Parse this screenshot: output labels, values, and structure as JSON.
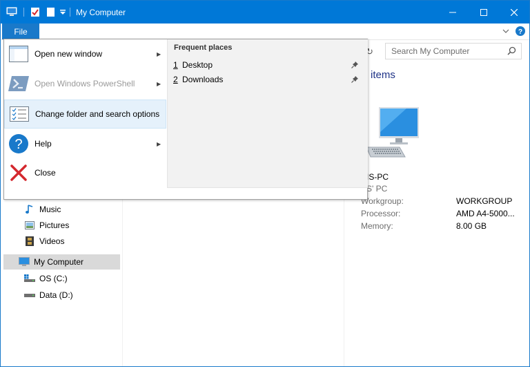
{
  "window": {
    "title": "My Computer"
  },
  "ribbon": {
    "file_tab": "File"
  },
  "search": {
    "placeholder": "Search My Computer"
  },
  "content": {
    "heading": "items",
    "pc_name": "IS-PC",
    "pc_sub": "S' PC",
    "details": [
      {
        "label": "Workgroup:",
        "value": "WORKGROUP"
      },
      {
        "label": "Processor:",
        "value": "AMD A4-5000..."
      },
      {
        "label": "Memory:",
        "value": "8.00 GB"
      }
    ]
  },
  "nav": {
    "items": [
      {
        "label": "Music",
        "icon": "music-note-icon"
      },
      {
        "label": "Pictures",
        "icon": "picture-icon"
      },
      {
        "label": "Videos",
        "icon": "film-icon"
      },
      {
        "label": "My Computer",
        "icon": "computer-icon"
      },
      {
        "label": "OS (C:)",
        "icon": "drive-os-icon"
      },
      {
        "label": "Data (D:)",
        "icon": "drive-icon"
      }
    ]
  },
  "file_menu": {
    "items": [
      {
        "label": "Open new window",
        "icon": "window-icon",
        "has_submenu": true,
        "disabled": false
      },
      {
        "label": "Open Windows PowerShell",
        "icon": "powershell-icon",
        "has_submenu": true,
        "disabled": true
      },
      {
        "label": "Change folder and search options",
        "icon": "options-icon",
        "has_submenu": false,
        "disabled": false,
        "highlighted": true
      },
      {
        "label": "Help",
        "icon": "help-icon",
        "has_submenu": true,
        "disabled": false
      },
      {
        "label": "Close",
        "icon": "close-x-icon",
        "has_submenu": false,
        "disabled": false
      }
    ],
    "frequent_title": "Frequent places",
    "frequent": [
      {
        "num": "1",
        "label": "Desktop"
      },
      {
        "num": "2",
        "label": "Downloads"
      }
    ]
  },
  "colors": {
    "titlebar": "#0078d7",
    "file_tab": "#1979ca",
    "heading": "#1e3287",
    "close_red": "#d4282e"
  }
}
